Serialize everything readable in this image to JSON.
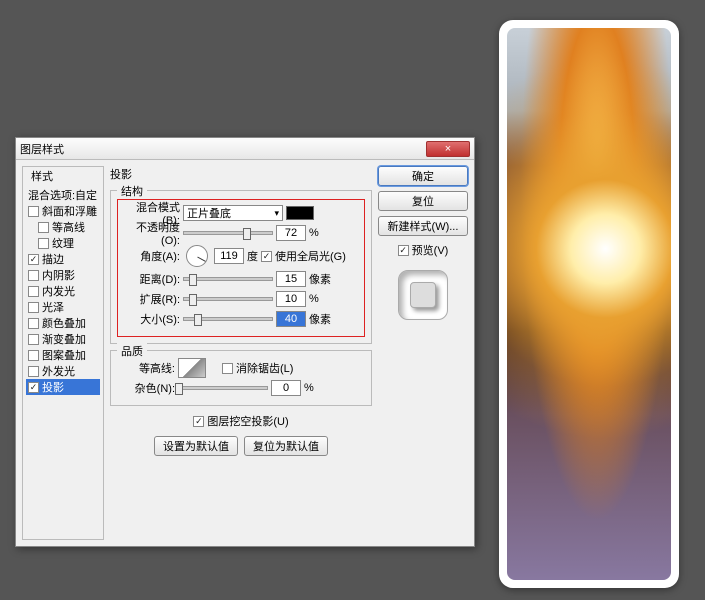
{
  "dialog": {
    "title": "图层样式",
    "close_glyph": "×"
  },
  "styles_panel": {
    "title": "样式",
    "blend_options": "混合选项:自定",
    "items": [
      {
        "label": "斜面和浮雕",
        "checked": false
      },
      {
        "label": "等高线",
        "checked": false,
        "indent": true
      },
      {
        "label": "纹理",
        "checked": false,
        "indent": true
      },
      {
        "label": "描边",
        "checked": true
      },
      {
        "label": "内阴影",
        "checked": false
      },
      {
        "label": "内发光",
        "checked": false
      },
      {
        "label": "光泽",
        "checked": false
      },
      {
        "label": "颜色叠加",
        "checked": false
      },
      {
        "label": "渐变叠加",
        "checked": false
      },
      {
        "label": "图案叠加",
        "checked": false
      },
      {
        "label": "外发光",
        "checked": false
      },
      {
        "label": "投影",
        "checked": true,
        "selected": true
      }
    ]
  },
  "section_label": "投影",
  "structure": {
    "title": "结构",
    "blend_mode_label": "混合模式(B):",
    "blend_mode_value": "正片叠底",
    "opacity_label": "不透明度(O):",
    "opacity_value": "72",
    "opacity_unit": "%",
    "angle_label": "角度(A):",
    "angle_value": "119",
    "angle_unit": "度",
    "global_light_label": "使用全局光(G)",
    "global_light_checked": true,
    "distance_label": "距离(D):",
    "distance_value": "15",
    "distance_unit": "像素",
    "spread_label": "扩展(R):",
    "spread_value": "10",
    "spread_unit": "%",
    "size_label": "大小(S):",
    "size_value": "40",
    "size_unit": "像素"
  },
  "quality": {
    "title": "品质",
    "contour_label": "等高线:",
    "antialias_label": "消除锯齿(L)",
    "antialias_checked": false,
    "noise_label": "杂色(N):",
    "noise_value": "0",
    "noise_unit": "%"
  },
  "knockout": {
    "label": "图层挖空投影(U)",
    "checked": true,
    "reset_default": "设置为默认值",
    "revert_default": "复位为默认值"
  },
  "buttons": {
    "ok": "确定",
    "cancel": "复位",
    "new_style": "新建样式(W)...",
    "preview_label": "预览(V)",
    "preview_checked": true
  }
}
